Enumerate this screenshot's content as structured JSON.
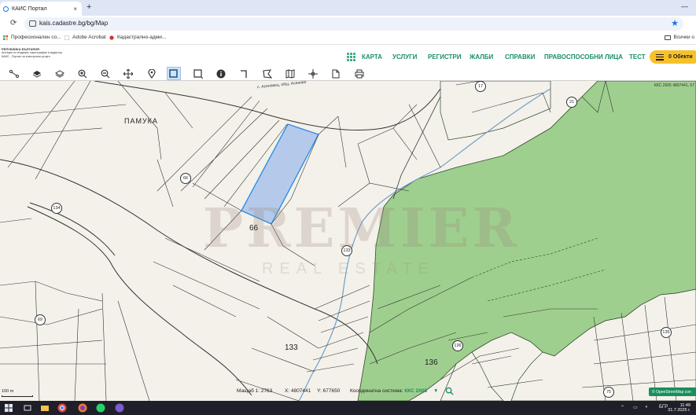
{
  "browser": {
    "tab_title": "КАИС Портал",
    "tab_close": "×",
    "new_tab": "+",
    "minimize": "—",
    "reload": "⟳",
    "url": "kais.cadastre.bg/bg/Map",
    "bookmark_star": "★"
  },
  "bookmarks": [
    {
      "label": "Професионален со..."
    },
    {
      "label": "Adobe Acrobat"
    },
    {
      "label": "Кадастрално-адми..."
    }
  ],
  "bookmarks_all": "Всички о",
  "logo": {
    "line1": "РЕПУБЛИКА БЪЛГАРИЯ",
    "line2": "Агенция по геодезия, картография и кадастър",
    "line3": "КАИС - Портал за електронни услуги"
  },
  "menu": [
    "КАРТА",
    "УСЛУГИ",
    "РЕГИСТРИ",
    "ЖАЛБИ",
    "СПРАВКИ",
    "ПРАВОСПОСОБНИ ЛИЦА",
    "ТЕСТ"
  ],
  "objects_button": "0 Обекти",
  "map": {
    "area_name": "ПАМУКА",
    "street_name": "с. Асеновец, общ. Асеново",
    "coord_note": "ККС 2005 4807441, 67",
    "parcel_labels": [
      "66",
      "133",
      "136"
    ],
    "circle_labels": [
      "66",
      "134",
      "133",
      "69",
      "136",
      "135",
      "17",
      "21",
      "75"
    ],
    "watermark": "PREMIER",
    "watermark_sub": "REAL ESTATE",
    "scale_label": "100 m",
    "osm": "© OpenStreetMap con"
  },
  "status": {
    "scale_label": "Мащаб 1:",
    "scale_value": "2763",
    "x_label": "X:",
    "x_value": "4807441",
    "y_label": "Y:",
    "y_value": "677650",
    "coord_system_label": "Координатна система:",
    "coord_system_value": "ККС 2005",
    "dropdown": "▼"
  },
  "taskbar": {
    "time": "11:49",
    "date": "31.7.2025 г.",
    "lang": "БГР"
  },
  "colors": {
    "accent_green": "#1b8f6a",
    "objects_yellow": "#f7c12c",
    "forest_green": "#9fcf8f",
    "selected_parcel": "#a9c3ea"
  }
}
